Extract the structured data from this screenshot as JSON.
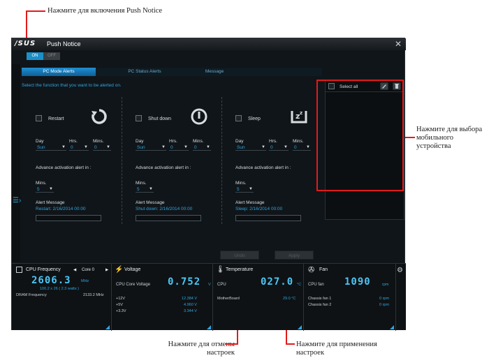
{
  "annotations": {
    "push_toggle": "Нажмите для включения Push Notice",
    "device_select": "Нажмите для выбора мобильного устройства",
    "undo": "Нажмите для отмены настроек",
    "apply": "Нажмите для применения настроек"
  },
  "window": {
    "logo": "/SUS",
    "title": "Push Notice",
    "close": "✕"
  },
  "toggle": {
    "on": "ON",
    "off": "OFF"
  },
  "tabs": [
    "PC Mode Alerts",
    "PC Status Alerts",
    "Message"
  ],
  "hint": "Select the function that you want to be alerted on.",
  "functions": [
    {
      "name": "Restart",
      "icon": "restart-icon",
      "day": "Sun",
      "hrs": "0",
      "mins": "0",
      "adv": "5",
      "message": "Restart: 2/16/2014 00:00"
    },
    {
      "name": "Shut down",
      "icon": "power-icon",
      "day": "Sun",
      "hrs": "0",
      "mins": "0",
      "adv": "5",
      "message": "Shut down: 2/16/2014 00:00"
    },
    {
      "name": "Sleep",
      "icon": "sleep-icon",
      "day": "Sun",
      "hrs": "0",
      "mins": "0",
      "adv": "5",
      "message": "Sleep: 2/16/2014 00:00"
    }
  ],
  "labels": {
    "day": "Day",
    "hrs": "Hrs.",
    "mins": "Mins.",
    "advance": "Advance activation alert in :",
    "mins2": "Mins.",
    "alert_message": "Alert Message"
  },
  "device": {
    "select_all": "Select all"
  },
  "buttons": {
    "undo": "Undo",
    "apply": "Apply"
  },
  "monitor": {
    "cpu": {
      "title": "CPU Frequency",
      "core": "Core 0",
      "value": "2606.3",
      "unit": "MHz",
      "detail": "100.2  x  26  ( 2.3   watts )",
      "dram_label": "DRAM Frequency",
      "dram_value": "2133.2  MHz"
    },
    "voltage": {
      "title": "Voltage",
      "core_label": "CPU Core Voltage",
      "value": "0.752",
      "unit": "V",
      "rows": [
        {
          "name": "+12V",
          "value": "12.384  V"
        },
        {
          "name": "+5V",
          "value": "4.960  V"
        },
        {
          "name": "+3.3V",
          "value": "3.344  V"
        }
      ]
    },
    "temperature": {
      "title": "Temperature",
      "cpu_label": "CPU",
      "value": "027.0",
      "unit": "°C",
      "mb_label": "MotherBoard",
      "mb_value": "29.0 °C"
    },
    "fan": {
      "title": "Fan",
      "cpu_label": "CPU fan",
      "value": "1090",
      "unit": "rpm",
      "rows": [
        {
          "name": "Chassis fan 1",
          "value": "0  rpm"
        },
        {
          "name": "Chassis fan 2",
          "value": "0  rpm"
        }
      ]
    }
  }
}
